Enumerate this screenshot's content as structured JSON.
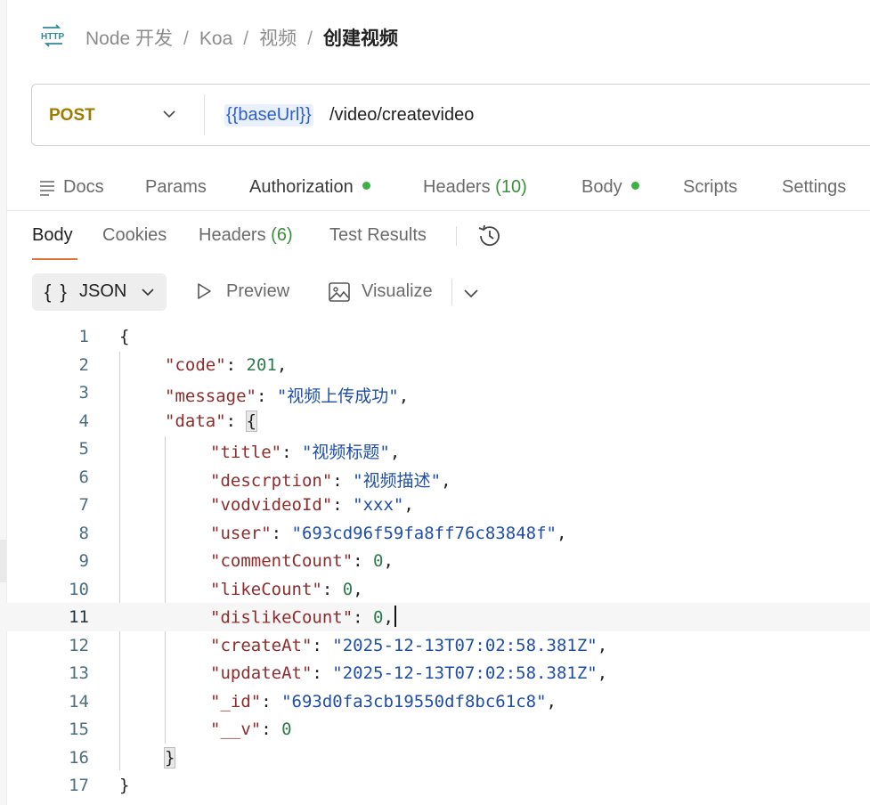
{
  "breadcrumb": {
    "icon": "http-icon",
    "items": [
      "Node 开发",
      "Koa",
      "视频"
    ],
    "current": "创建视频",
    "separator": "/"
  },
  "request": {
    "method": "POST",
    "url_variable": "{{baseUrl}}",
    "url_path": "/video/createvideo"
  },
  "request_tabs": {
    "docs": "Docs",
    "params": "Params",
    "authorization": "Authorization",
    "headers": "Headers",
    "headers_count": "(10)",
    "body": "Body",
    "scripts": "Scripts",
    "settings": "Settings"
  },
  "response_tabs": {
    "body": "Body",
    "cookies": "Cookies",
    "headers": "Headers",
    "headers_count": "(6)",
    "test_results": "Test Results"
  },
  "toolbar": {
    "format_braces": "{ }",
    "format": "JSON",
    "preview": "Preview",
    "visualize": "Visualize"
  },
  "colors": {
    "method": "#a07b00",
    "active_tab_underline": "#e07438",
    "status_dot": "#3cb043",
    "string": "#1f4ea8",
    "key": "#8e2c2c",
    "number": "#2e7a4c"
  },
  "code": {
    "active_line": 11,
    "lines": [
      {
        "n": "1",
        "indent": 0,
        "parts": [
          [
            "p",
            "{"
          ]
        ]
      },
      {
        "n": "2",
        "indent": 1,
        "parts": [
          [
            "k",
            "\"code\""
          ],
          [
            "p",
            ": "
          ],
          [
            "n",
            "201"
          ],
          [
            "p",
            ","
          ]
        ]
      },
      {
        "n": "3",
        "indent": 1,
        "parts": [
          [
            "k",
            "\"message\""
          ],
          [
            "p",
            ": "
          ],
          [
            "s",
            "\"视频上传成功\""
          ],
          [
            "p",
            ","
          ]
        ]
      },
      {
        "n": "4",
        "indent": 1,
        "parts": [
          [
            "k",
            "\"data\""
          ],
          [
            "p",
            ": "
          ],
          [
            "b",
            "{"
          ]
        ]
      },
      {
        "n": "5",
        "indent": 2,
        "parts": [
          [
            "k",
            "\"title\""
          ],
          [
            "p",
            ": "
          ],
          [
            "s",
            "\"视频标题\""
          ],
          [
            "p",
            ","
          ]
        ]
      },
      {
        "n": "6",
        "indent": 2,
        "parts": [
          [
            "k",
            "\"descrption\""
          ],
          [
            "p",
            ": "
          ],
          [
            "s",
            "\"视频描述\""
          ],
          [
            "p",
            ","
          ]
        ]
      },
      {
        "n": "7",
        "indent": 2,
        "parts": [
          [
            "k",
            "\"vodvideoId\""
          ],
          [
            "p",
            ": "
          ],
          [
            "s",
            "\"xxx\""
          ],
          [
            "p",
            ","
          ]
        ]
      },
      {
        "n": "8",
        "indent": 2,
        "parts": [
          [
            "k",
            "\"user\""
          ],
          [
            "p",
            ": "
          ],
          [
            "s",
            "\"693cd96f59fa8ff76c83848f\""
          ],
          [
            "p",
            ","
          ]
        ]
      },
      {
        "n": "9",
        "indent": 2,
        "parts": [
          [
            "k",
            "\"commentCount\""
          ],
          [
            "p",
            ": "
          ],
          [
            "n",
            "0"
          ],
          [
            "p",
            ","
          ]
        ]
      },
      {
        "n": "10",
        "indent": 2,
        "parts": [
          [
            "k",
            "\"likeCount\""
          ],
          [
            "p",
            ": "
          ],
          [
            "n",
            "0"
          ],
          [
            "p",
            ","
          ]
        ]
      },
      {
        "n": "11",
        "indent": 2,
        "parts": [
          [
            "k",
            "\"dislikeCount\""
          ],
          [
            "p",
            ": "
          ],
          [
            "n",
            "0"
          ],
          [
            "p",
            ","
          ],
          [
            "c",
            ""
          ]
        ]
      },
      {
        "n": "12",
        "indent": 2,
        "parts": [
          [
            "k",
            "\"createAt\""
          ],
          [
            "p",
            ": "
          ],
          [
            "s",
            "\"2025-12-13T07:02:58.381Z\""
          ],
          [
            "p",
            ","
          ]
        ]
      },
      {
        "n": "13",
        "indent": 2,
        "parts": [
          [
            "k",
            "\"updateAt\""
          ],
          [
            "p",
            ": "
          ],
          [
            "s",
            "\"2025-12-13T07:02:58.381Z\""
          ],
          [
            "p",
            ","
          ]
        ]
      },
      {
        "n": "14",
        "indent": 2,
        "parts": [
          [
            "k",
            "\"_id\""
          ],
          [
            "p",
            ": "
          ],
          [
            "s",
            "\"693d0fa3cb19550df8bc61c8\""
          ],
          [
            "p",
            ","
          ]
        ]
      },
      {
        "n": "15",
        "indent": 2,
        "parts": [
          [
            "k",
            "\"__v\""
          ],
          [
            "p",
            ": "
          ],
          [
            "n",
            "0"
          ]
        ]
      },
      {
        "n": "16",
        "indent": 1,
        "parts": [
          [
            "b",
            "}"
          ]
        ]
      },
      {
        "n": "17",
        "indent": 0,
        "parts": [
          [
            "p",
            "}"
          ]
        ]
      }
    ]
  }
}
